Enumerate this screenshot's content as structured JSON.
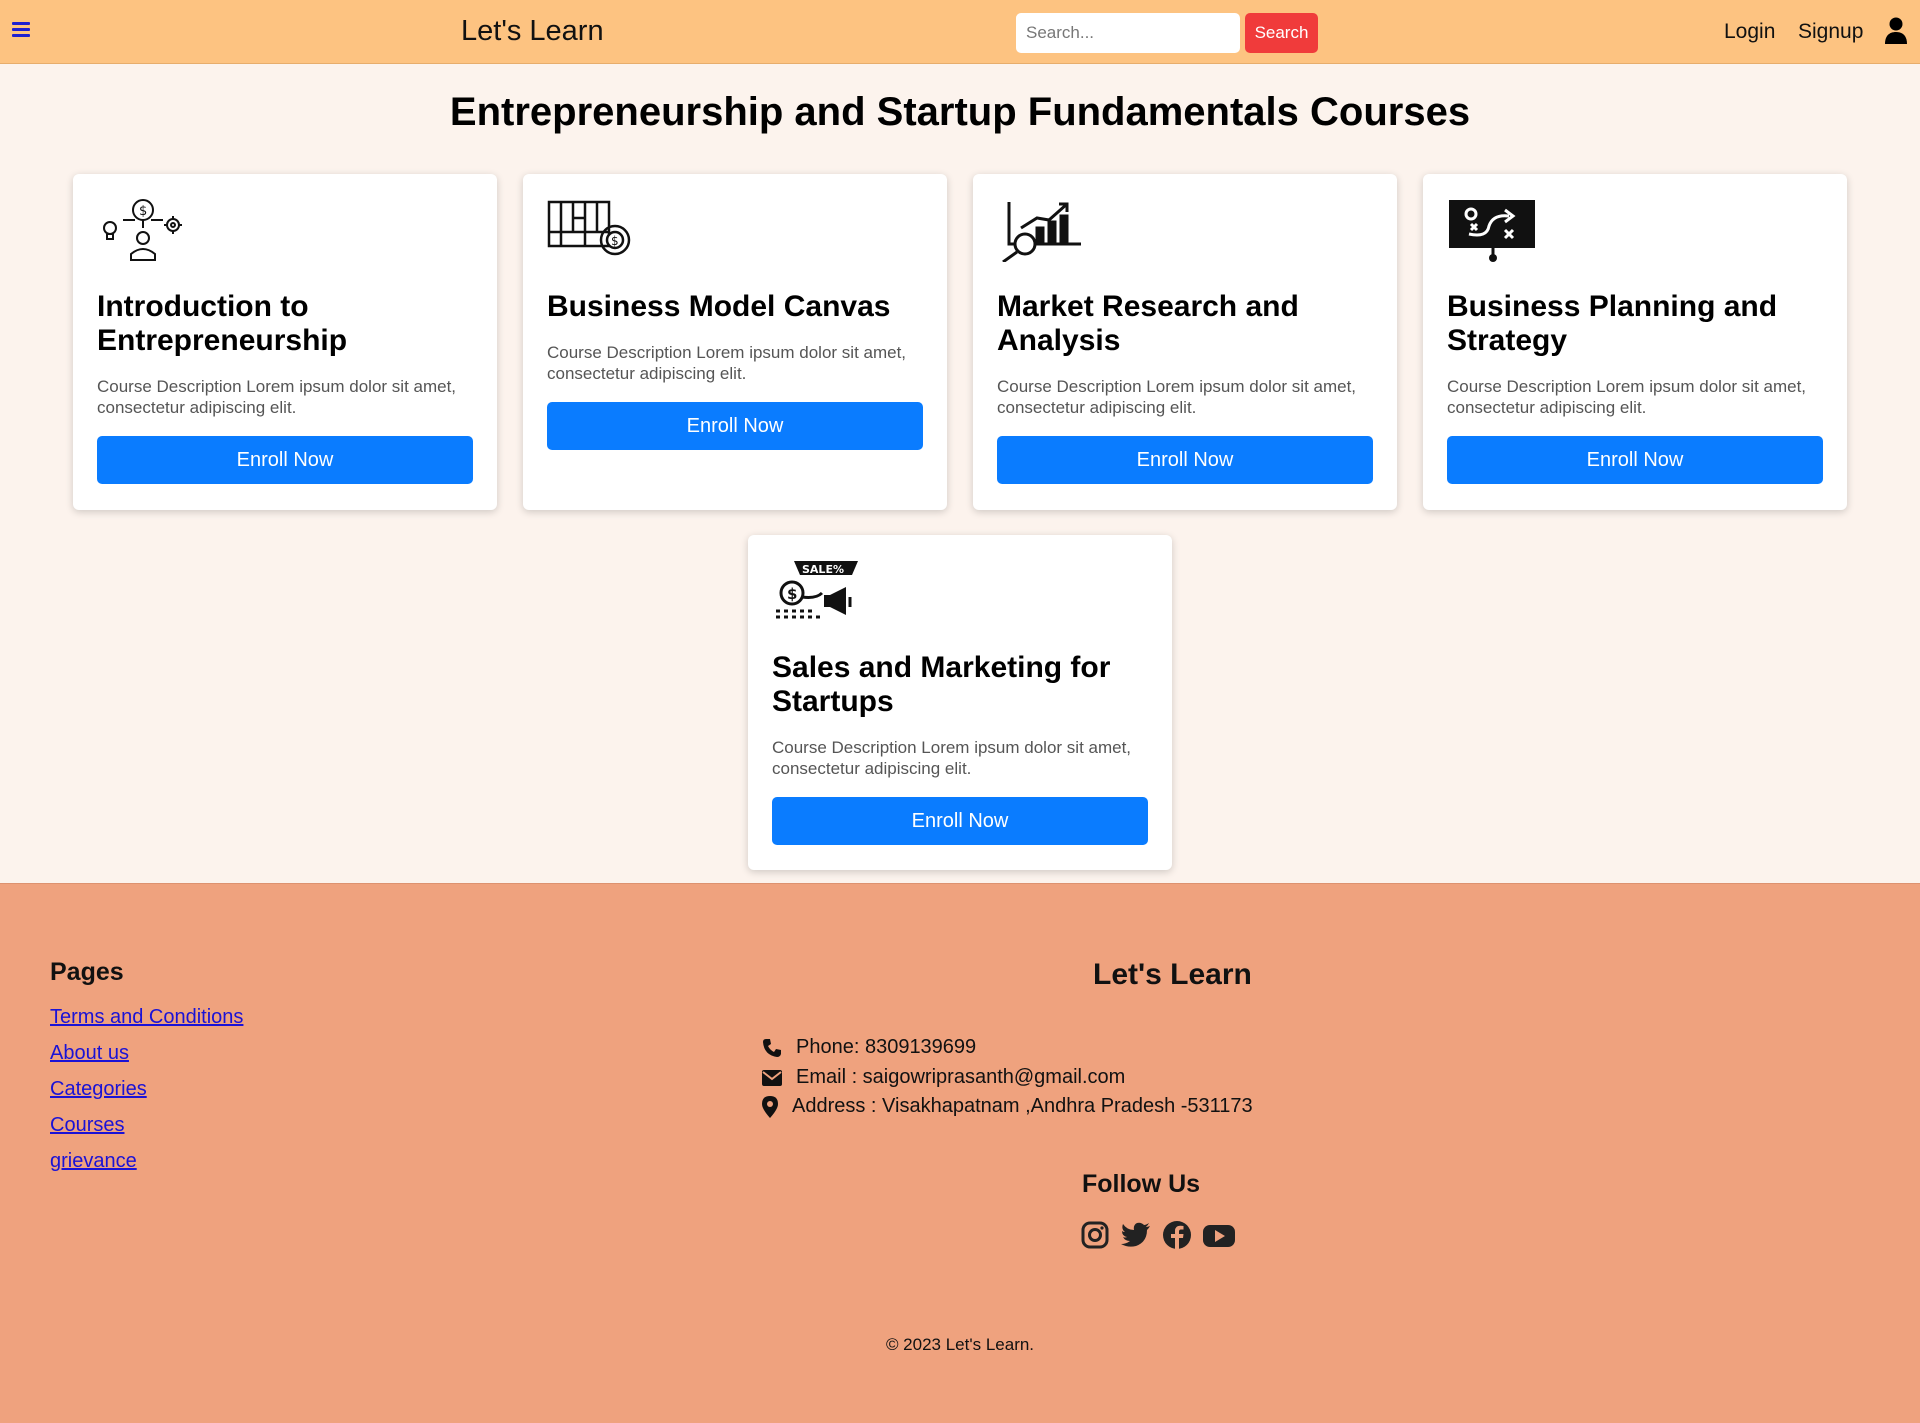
{
  "navbar": {
    "brand": "Let's Learn",
    "search_placeholder": "Search...",
    "search_button": "Search",
    "login": "Login",
    "signup": "Signup"
  },
  "main": {
    "title": "Entrepreneurship and Startup Fundamentals Courses",
    "courses": [
      {
        "title": "Introduction to Entrepreneurship",
        "description": "Course Description Lorem ipsum dolor sit amet, consectetur adipiscing elit.",
        "button": "Enroll Now",
        "icon": "entrepreneur-idea-icon"
      },
      {
        "title": "Business Model Canvas",
        "description": "Course Description Lorem ipsum dolor sit amet, consectetur adipiscing elit.",
        "button": "Enroll Now",
        "icon": "business-model-canvas-icon"
      },
      {
        "title": "Market Research and Analysis",
        "description": "Course Description Lorem ipsum dolor sit amet, consectetur adipiscing elit.",
        "button": "Enroll Now",
        "icon": "market-research-icon"
      },
      {
        "title": "Business Planning and Strategy",
        "description": "Course Description Lorem ipsum dolor sit amet, consectetur adipiscing elit.",
        "button": "Enroll Now",
        "icon": "strategy-board-icon"
      },
      {
        "title": "Sales and Marketing for Startups",
        "description": "Course Description Lorem ipsum dolor sit amet, consectetur adipiscing elit.",
        "button": "Enroll Now",
        "icon": "sales-marketing-icon"
      }
    ]
  },
  "footer": {
    "pages_heading": "Pages",
    "pages": [
      "Terms and Conditions",
      "About us",
      "Categories",
      "Courses",
      "grievance"
    ],
    "brand": "Let's Learn",
    "phone": "Phone: 8309139699",
    "email": "Email : saigowriprasanth@gmail.com",
    "address": "Address : Visakhapatnam ,Andhra Pradesh -531173",
    "follow_heading": "Follow Us",
    "socials": [
      "instagram-icon",
      "twitter-icon",
      "facebook-icon",
      "youtube-icon"
    ],
    "copyright": "© 2023 Let's Learn."
  },
  "colors": {
    "navbar_bg": "#fdc381",
    "page_bg": "#fcf3ed",
    "footer_bg": "#efa27e",
    "primary_button": "#0a7cff",
    "search_button": "#f03b3b",
    "link": "#1a12d6"
  }
}
